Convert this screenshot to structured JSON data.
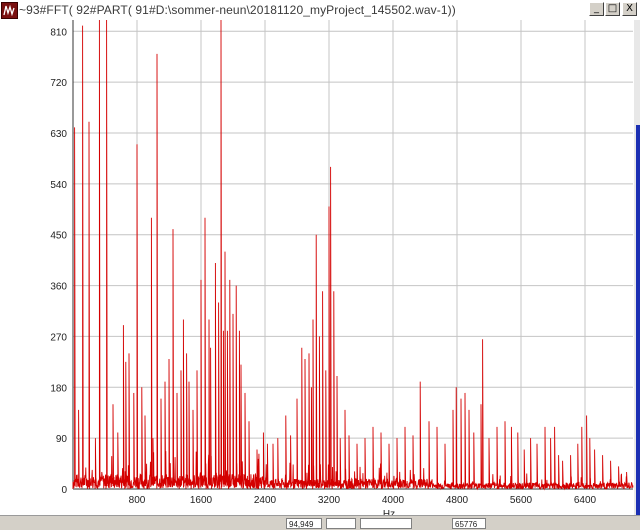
{
  "window": {
    "title": "~93#FFT( 92#PART( 91#D:\\sommer-neun\\20181120_myProject_145502.wav-1))",
    "buttons": [
      "_",
      "□",
      "X"
    ]
  },
  "chart_data": {
    "type": "line",
    "title": "",
    "xlabel": "Hz",
    "ylabel": "",
    "xlim": [
      0,
      7000
    ],
    "ylim": [
      0,
      830
    ],
    "grid": true,
    "x_ticks": [
      "800",
      "1600",
      "2400",
      "3200",
      "4000",
      "4800",
      "5600",
      "6400"
    ],
    "y_ticks": [
      "0",
      "90",
      "180",
      "270",
      "360",
      "450",
      "540",
      "630",
      "720",
      "810"
    ],
    "line_color": "#d40000",
    "series": [
      {
        "name": "",
        "peaks": [
          [
            20,
            640
          ],
          [
            70,
            140
          ],
          [
            120,
            820
          ],
          [
            200,
            650
          ],
          [
            280,
            90
          ],
          [
            330,
            830
          ],
          [
            420,
            830
          ],
          [
            500,
            150
          ],
          [
            560,
            100
          ],
          [
            630,
            290
          ],
          [
            660,
            225
          ],
          [
            700,
            240
          ],
          [
            760,
            170
          ],
          [
            800,
            610
          ],
          [
            860,
            180
          ],
          [
            900,
            130
          ],
          [
            980,
            480
          ],
          [
            1000,
            90
          ],
          [
            1050,
            770
          ],
          [
            1100,
            160
          ],
          [
            1150,
            190
          ],
          [
            1200,
            230
          ],
          [
            1250,
            460
          ],
          [
            1300,
            170
          ],
          [
            1350,
            210
          ],
          [
            1380,
            300
          ],
          [
            1420,
            240
          ],
          [
            1450,
            190
          ],
          [
            1500,
            140
          ],
          [
            1550,
            210
          ],
          [
            1600,
            370
          ],
          [
            1650,
            480
          ],
          [
            1700,
            300
          ],
          [
            1720,
            250
          ],
          [
            1780,
            400
          ],
          [
            1820,
            330
          ],
          [
            1850,
            830
          ],
          [
            1880,
            280
          ],
          [
            1900,
            420
          ],
          [
            1930,
            280
          ],
          [
            1960,
            370
          ],
          [
            2000,
            310
          ],
          [
            2040,
            360
          ],
          [
            2080,
            280
          ],
          [
            2100,
            220
          ],
          [
            2150,
            170
          ],
          [
            2200,
            120
          ],
          [
            2300,
            70
          ],
          [
            2380,
            100
          ],
          [
            2430,
            80
          ],
          [
            2500,
            80
          ],
          [
            2560,
            90
          ],
          [
            2660,
            130
          ],
          [
            2720,
            95
          ],
          [
            2800,
            160
          ],
          [
            2860,
            250
          ],
          [
            2900,
            230
          ],
          [
            2950,
            240
          ],
          [
            2980,
            180
          ],
          [
            3000,
            300
          ],
          [
            3040,
            450
          ],
          [
            3080,
            270
          ],
          [
            3120,
            350
          ],
          [
            3160,
            210
          ],
          [
            3200,
            500
          ],
          [
            3220,
            570
          ],
          [
            3260,
            350
          ],
          [
            3300,
            200
          ],
          [
            3340,
            90
          ],
          [
            3400,
            140
          ],
          [
            3450,
            95
          ],
          [
            3550,
            80
          ],
          [
            3650,
            90
          ],
          [
            3750,
            110
          ],
          [
            3850,
            100
          ],
          [
            3950,
            80
          ],
          [
            4050,
            90
          ],
          [
            4150,
            110
          ],
          [
            4250,
            95
          ],
          [
            4340,
            190
          ],
          [
            4450,
            120
          ],
          [
            4550,
            110
          ],
          [
            4650,
            80
          ],
          [
            4750,
            140
          ],
          [
            4790,
            180
          ],
          [
            4850,
            160
          ],
          [
            4900,
            170
          ],
          [
            4950,
            140
          ],
          [
            5010,
            100
          ],
          [
            5100,
            150
          ],
          [
            5120,
            265
          ],
          [
            5200,
            90
          ],
          [
            5300,
            110
          ],
          [
            5400,
            120
          ],
          [
            5480,
            110
          ],
          [
            5560,
            100
          ],
          [
            5640,
            70
          ],
          [
            5720,
            90
          ],
          [
            5800,
            80
          ],
          [
            5900,
            110
          ],
          [
            5970,
            90
          ],
          [
            6020,
            110
          ],
          [
            6070,
            60
          ],
          [
            6120,
            50
          ],
          [
            6220,
            60
          ],
          [
            6310,
            80
          ],
          [
            6360,
            110
          ],
          [
            6420,
            130
          ],
          [
            6460,
            90
          ],
          [
            6520,
            70
          ],
          [
            6620,
            60
          ],
          [
            6720,
            50
          ],
          [
            6820,
            40
          ],
          [
            6920,
            30
          ]
        ]
      }
    ]
  },
  "status": {
    "items": [
      "94,949",
      "65776"
    ]
  }
}
